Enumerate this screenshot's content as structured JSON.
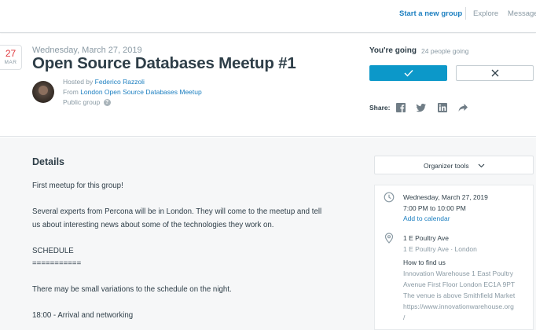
{
  "nav": {
    "start_group": "Start a new group",
    "explore": "Explore",
    "messages": "Message"
  },
  "event": {
    "badge_day": "27",
    "badge_month": "MAR",
    "date": "Wednesday, March 27, 2019",
    "title": "Open Source Databases Meetup #1",
    "hosted_by_prefix": "Hosted by ",
    "host_name": "Federico Razzoli",
    "from_prefix": "From ",
    "group_name": "London Open Source Databases Meetup",
    "group_type": "Public group"
  },
  "rsvp": {
    "status": "You're going",
    "count": "24 people going"
  },
  "share": {
    "label": "Share:"
  },
  "details": {
    "heading": "Details",
    "lines": [
      "First meetup for this group!",
      "Several experts from Percona will be in London. They will come to the meetup and tell us about interesting news about some of the technologies they work on.",
      "SCHEDULE",
      "===========",
      "There may be small variations to the schedule on the night.",
      "18:00 - Arrival and networking"
    ]
  },
  "sidebar": {
    "organizer_tools": "Organizer tools",
    "when_date": "Wednesday, March 27, 2019",
    "when_time": "7:00 PM to 10:00 PM",
    "add_to_calendar": "Add to calendar",
    "venue_name": "1 E Poultry Ave",
    "venue_address": "1 E Poultry Ave · London",
    "how_to_find_label": "How to find us",
    "how_to_find_lines": [
      "Innovation Warehouse 1 East Poultry",
      "Avenue First Floor London EC1A 9PT",
      "The venue is above Smithfield Market",
      "https://www.innovationwarehouse.org",
      "/"
    ]
  },
  "colors": {
    "brand_blue": "#0c98c9",
    "link_blue": "#1c7fc0",
    "date_red": "#e0393e"
  },
  "icons": [
    "check-icon",
    "close-icon",
    "facebook-icon",
    "twitter-icon",
    "linkedin-icon",
    "share-arrow-icon",
    "clock-icon",
    "location-pin-icon",
    "chevron-down-icon",
    "help-icon"
  ]
}
